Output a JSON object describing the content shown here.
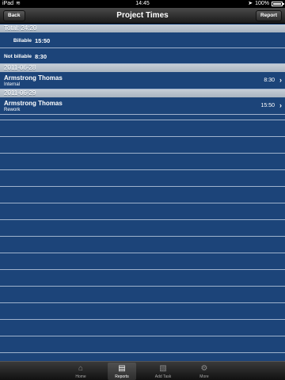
{
  "status_bar": {
    "carrier": "iPad",
    "time": "14:45",
    "battery": "100%",
    "battery_level": 1.0
  },
  "nav": {
    "title": "Project Times",
    "back_label": "Back",
    "report_label": "Report"
  },
  "totals": {
    "header": "Total: 24:20",
    "rows": [
      {
        "label": "Billable",
        "value": "15:50"
      },
      {
        "label": "Not billable",
        "value": "8:30"
      }
    ]
  },
  "entries": [
    {
      "date": "2011-06-28",
      "name": "Armstrong Thomas",
      "task": "Internal",
      "time": "8:30"
    },
    {
      "date": "2011-06-29",
      "name": "Armstrong Thomas",
      "task": "Rework",
      "time": "15:50"
    }
  ],
  "tabs": [
    {
      "label": "Home",
      "icon": "home-icon"
    },
    {
      "label": "Reports",
      "icon": "reports-icon"
    },
    {
      "label": "Add Task",
      "icon": "add-task-icon"
    },
    {
      "label": "More",
      "icon": "more-icon"
    }
  ],
  "colors": {
    "background": "#1c4479",
    "section_header": "#b8c1cc",
    "nav_bar": "#2a2a2a"
  }
}
